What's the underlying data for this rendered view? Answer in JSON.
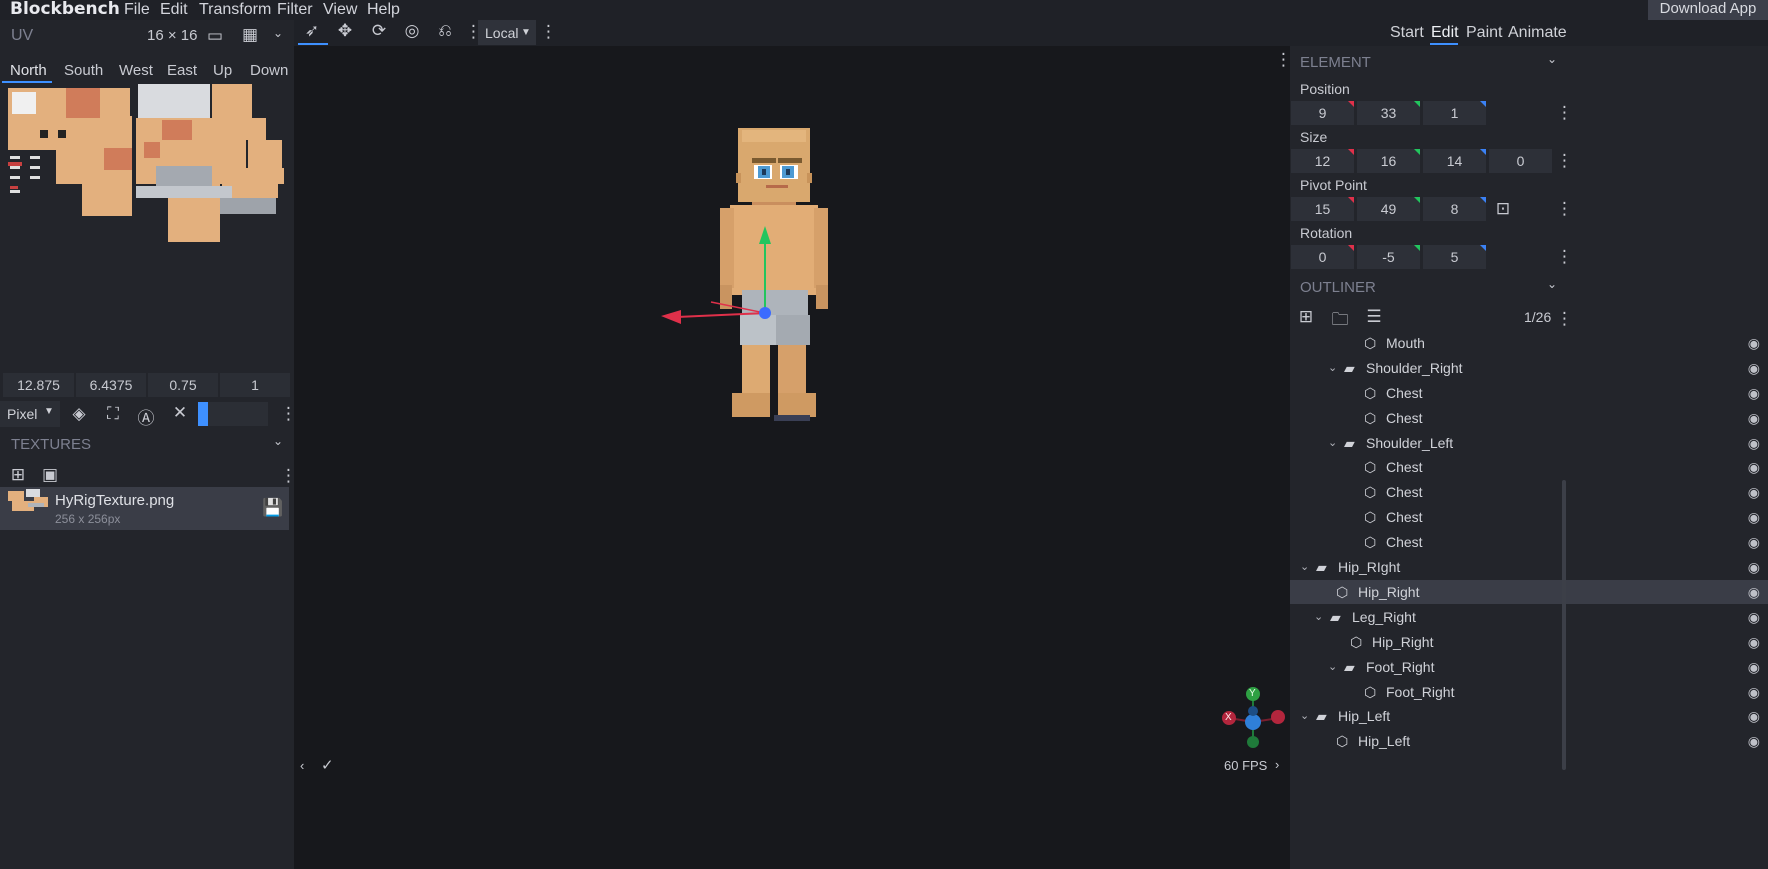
{
  "app": {
    "logo": "Blockbench",
    "download": "Download App"
  },
  "menu": [
    "File",
    "Edit",
    "Transform",
    "Filter",
    "View",
    "Help"
  ],
  "uv": {
    "title": "UV",
    "size": "16 × 16",
    "faces": [
      "North",
      "South",
      "West",
      "East",
      "Up",
      "Down"
    ],
    "active_face": "North",
    "coords": [
      "12.875",
      "6.4375",
      "0.75",
      "1"
    ],
    "mode": "Pixel"
  },
  "textures": {
    "title": "TEXTURES",
    "items": [
      {
        "name": "HyRigTexture.png",
        "size": "256 x 256px"
      }
    ]
  },
  "toolbar": {
    "space": "Local",
    "modes": [
      "Start",
      "Edit",
      "Paint",
      "Animate"
    ],
    "active_mode": "Edit"
  },
  "element": {
    "title": "ELEMENT",
    "position": {
      "label": "Position",
      "values": [
        "9",
        "33",
        "1"
      ]
    },
    "size": {
      "label": "Size",
      "values": [
        "12",
        "16",
        "14",
        "0"
      ]
    },
    "pivot": {
      "label": "Pivot Point",
      "values": [
        "15",
        "49",
        "8"
      ]
    },
    "rotation": {
      "label": "Rotation",
      "values": [
        "0",
        "-5",
        "5"
      ]
    }
  },
  "outliner": {
    "title": "OUTLINER",
    "count": "1/26",
    "rows": [
      {
        "type": "cube",
        "label": "Mouth",
        "indent": 3
      },
      {
        "type": "cube",
        "label": "Mouth",
        "indent": 3
      },
      {
        "type": "group",
        "label": "Shoulder_Right",
        "indent": 2
      },
      {
        "type": "cube",
        "label": "Chest",
        "indent": 3
      },
      {
        "type": "cube",
        "label": "Chest",
        "indent": 3
      },
      {
        "type": "group",
        "label": "Shoulder_Left",
        "indent": 2
      },
      {
        "type": "cube",
        "label": "Chest",
        "indent": 3
      },
      {
        "type": "cube",
        "label": "Chest",
        "indent": 3
      },
      {
        "type": "cube",
        "label": "Chest",
        "indent": 3
      },
      {
        "type": "cube",
        "label": "Chest",
        "indent": 3
      },
      {
        "type": "group",
        "label": "Hip_RIght",
        "indent": 0
      },
      {
        "type": "cube",
        "label": "Hip_Right",
        "indent": 1,
        "selected": true
      },
      {
        "type": "group",
        "label": "Leg_Right",
        "indent": 1
      },
      {
        "type": "cube",
        "label": "Hip_Right",
        "indent": 2
      },
      {
        "type": "group",
        "label": "Foot_Right",
        "indent": 2
      },
      {
        "type": "cube",
        "label": "Foot_Right",
        "indent": 3
      },
      {
        "type": "group",
        "label": "Hip_Left",
        "indent": 0
      },
      {
        "type": "cube",
        "label": "Hip_Left",
        "indent": 1
      }
    ]
  },
  "status": {
    "fps": "60 FPS"
  },
  "gizmo": {
    "y": "Y",
    "x": "X"
  }
}
